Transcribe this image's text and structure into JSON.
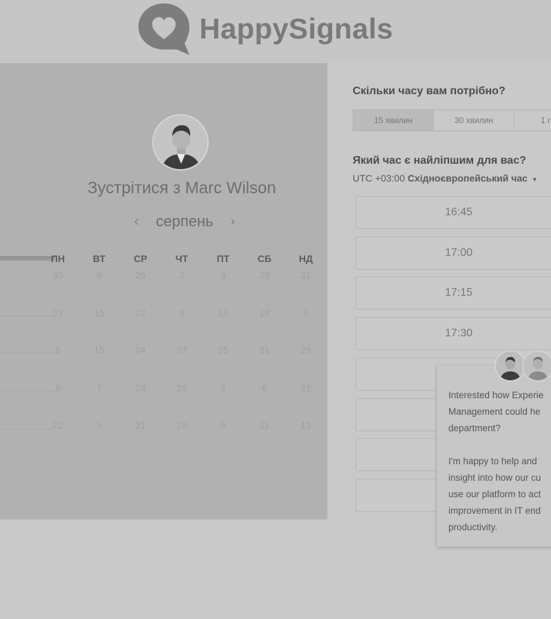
{
  "header": {
    "logo_text": "HappySignals"
  },
  "calendar": {
    "title": "Зустрітися з Marc Wilson",
    "month": "серпень",
    "prev_icon": "‹",
    "next_icon": "›",
    "weekdays": [
      "ПН",
      "ВТ",
      "СР",
      "ЧТ",
      "ПТ",
      "СБ",
      "НД"
    ],
    "weeks": [
      [
        "30",
        "8",
        "26",
        "2",
        "9",
        "25",
        "31"
      ],
      [
        "27",
        "15",
        "22",
        "6",
        "15",
        "18",
        "5"
      ],
      [
        "6",
        "15",
        "24",
        "27",
        "25",
        "31",
        "29"
      ],
      [
        "8",
        "7",
        "24",
        "29",
        "5",
        "6",
        "21"
      ],
      [
        "22",
        "5",
        "21",
        "28",
        "9",
        "11",
        "13"
      ]
    ]
  },
  "booking": {
    "duration_question": "Скільки часу вам потрібно?",
    "durations": [
      "15 хвилин",
      "30 хвилин",
      "1 г"
    ],
    "time_question": "Який час є найліпшим для вас?",
    "timezone_prefix": "UTC +03:00",
    "timezone_name": "Східноєвропейський час",
    "timezone_chevron": "▾",
    "slots": [
      "16:45",
      "17:00",
      "17:15",
      "17:30",
      "",
      "",
      ""
    ]
  },
  "chat": {
    "message": "Interested how Experie\nManagement could he\ndepartment?\n\nI'm happy to help and\ninsight into how our cu\nuse our platform to act\nimprovement in IT end\nproductivity."
  }
}
